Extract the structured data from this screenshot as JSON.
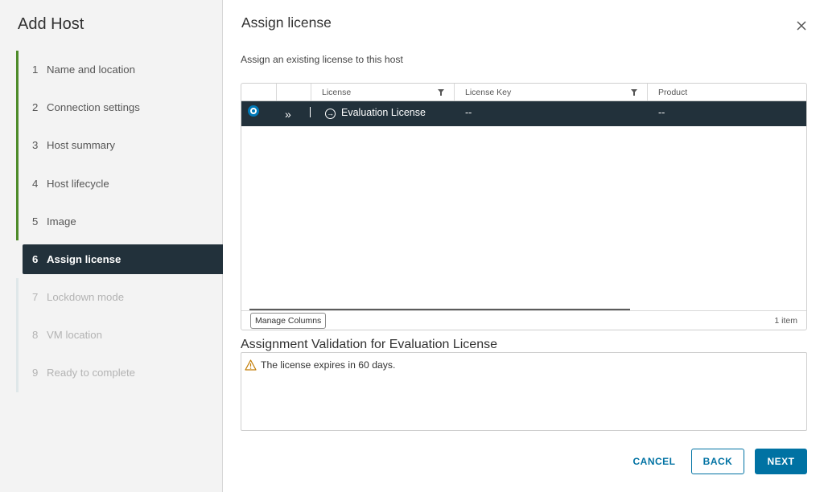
{
  "wizard": {
    "title": "Add Host",
    "steps": [
      {
        "num": "1",
        "label": "Name and location",
        "state": "done"
      },
      {
        "num": "2",
        "label": "Connection settings",
        "state": "done"
      },
      {
        "num": "3",
        "label": "Host summary",
        "state": "done"
      },
      {
        "num": "4",
        "label": "Host lifecycle",
        "state": "done"
      },
      {
        "num": "5",
        "label": "Image",
        "state": "done"
      },
      {
        "num": "6",
        "label": "Assign license",
        "state": "active"
      },
      {
        "num": "7",
        "label": "Lockdown mode",
        "state": "disabled"
      },
      {
        "num": "8",
        "label": "VM location",
        "state": "disabled"
      },
      {
        "num": "9",
        "label": "Ready to complete",
        "state": "disabled"
      }
    ]
  },
  "page": {
    "title": "Assign license",
    "subtitle": "Assign an existing license to this host"
  },
  "grid": {
    "columns": {
      "license": "License",
      "license_key": "License Key",
      "product": "Product"
    },
    "rows": [
      {
        "license": "Evaluation License",
        "license_key": "--",
        "product": "--",
        "selected": true
      }
    ],
    "manage_columns": "Manage Columns",
    "count": "1 item"
  },
  "validation": {
    "title": "Assignment Validation for Evaluation License",
    "message": "The license expires in 60 days."
  },
  "footer": {
    "cancel": "CANCEL",
    "back": "BACK",
    "next": "NEXT"
  },
  "colors": {
    "primary": "#0072a3",
    "nav_active": "#22313b",
    "step_done": "#4e8b2a",
    "warning": "#c27b00"
  }
}
